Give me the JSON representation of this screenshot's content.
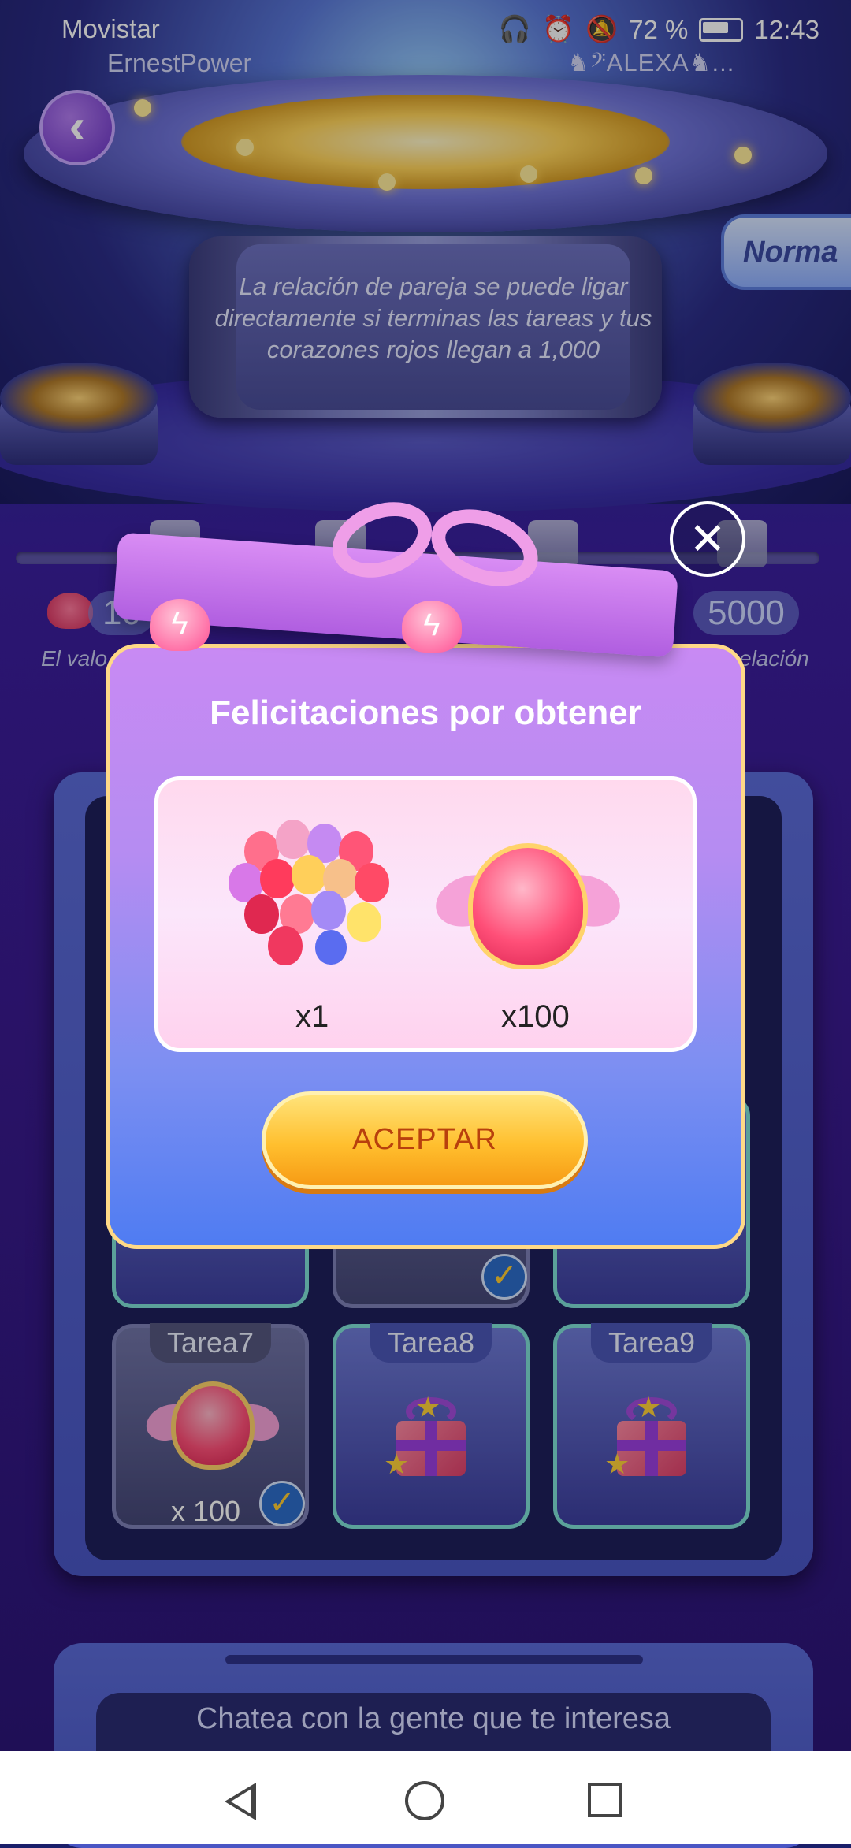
{
  "status_bar": {
    "carrier": "Movistar",
    "battery": "72 %",
    "time": "12:43"
  },
  "header": {
    "user_left": "ErnestPower",
    "user_right": "♞𝄢ALEXA♞..."
  },
  "mode_button": "Norma",
  "stage_message": "La relación de pareja se puede ligar directamente si terminas las tareas y tus corazones rojos llegan a 1,000",
  "progress": {
    "current_value_partial": "10",
    "target_value_partial": "5000",
    "caption_left_partial": "El valo",
    "caption_right_partial": "elación"
  },
  "tasks": [
    {
      "label": "Tarea7",
      "reward": "heart",
      "amount": "x 100",
      "completed": true
    },
    {
      "label": "Tarea8",
      "reward": "gift",
      "completed": false
    },
    {
      "label": "Tarea9",
      "reward": "gift",
      "completed": false
    }
  ],
  "chat_prompt": "Chatea con la gente que te interesa",
  "dialog": {
    "title": "Felicitaciones por obtener",
    "rewards": [
      {
        "icon": "balloons-icon",
        "quantity": "x1"
      },
      {
        "icon": "winged-heart-icon",
        "quantity": "x100"
      }
    ],
    "accept_label": "ACEPTAR",
    "close_icon": "close-icon"
  },
  "colors": {
    "accent_gold": "#ffbf2e",
    "accept_text": "#b8400d",
    "dialog_border": "#ffd987"
  }
}
